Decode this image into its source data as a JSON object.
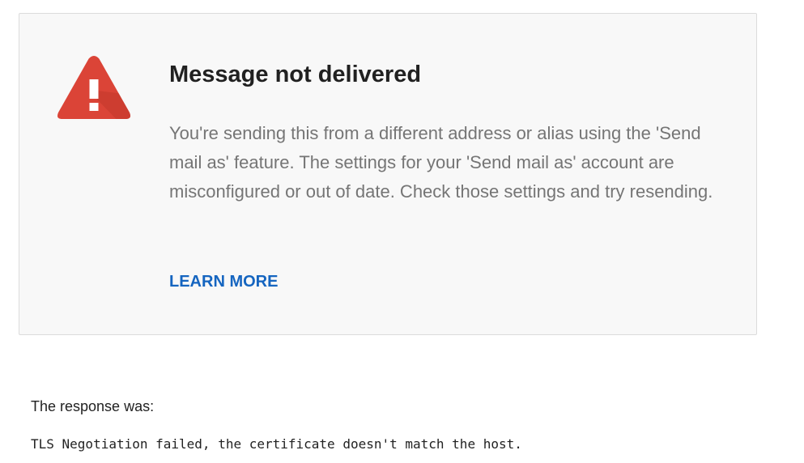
{
  "notice": {
    "icon": "warning-triangle-icon",
    "icon_color": "#db4437",
    "title": "Message not delivered",
    "message": "You're sending this from a different address or alias using the 'Send mail as' feature. The settings for your 'Send mail as' account are misconfigured or out of date. Check those settings and try resending.",
    "learn_more_label": "LEARN MORE",
    "link_color": "#1565c0"
  },
  "response": {
    "label": "The response was:",
    "detail": "TLS Negotiation failed, the certificate doesn't match the host."
  }
}
